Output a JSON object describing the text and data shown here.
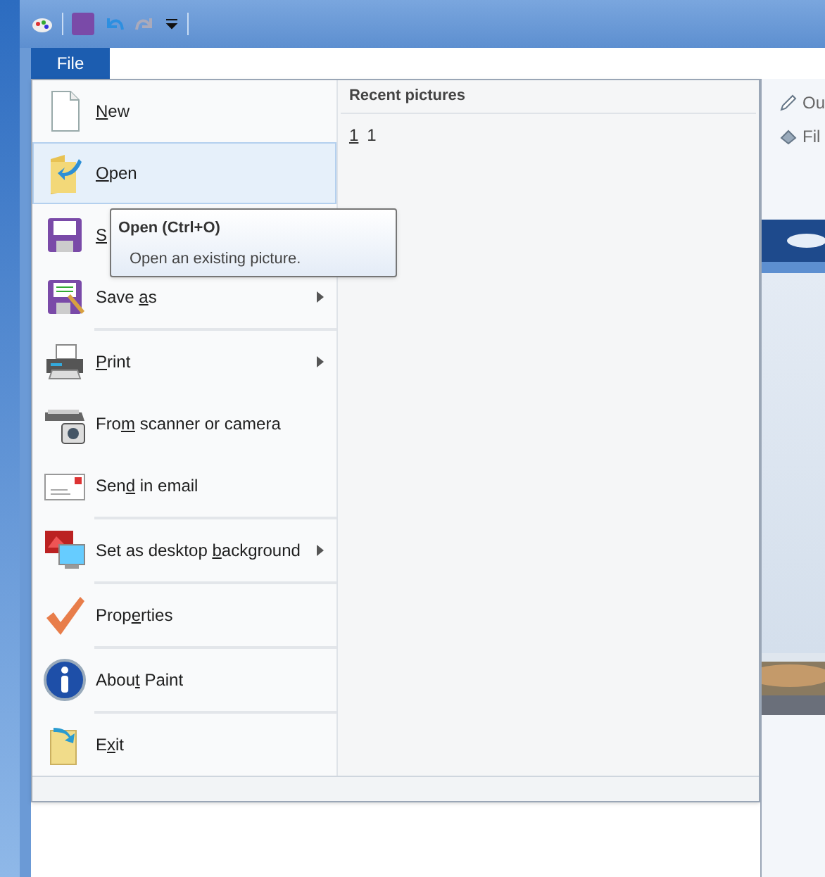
{
  "file_tab": {
    "label": "File",
    "selected": true
  },
  "menu": {
    "sections": [
      [
        {
          "key": "N",
          "post": "ew",
          "selected": false,
          "has_submenu": false
        },
        {
          "key": "O",
          "post": "pen",
          "selected": true,
          "has_submenu": false
        },
        {
          "key": "S",
          "selected": false,
          "has_submenu": false
        },
        {
          "pre": "Save ",
          "key": "a",
          "post": "s",
          "selected": false,
          "has_submenu": true
        }
      ],
      [
        {
          "key": "P",
          "post": "rint",
          "selected": false,
          "has_submenu": true
        },
        {
          "pre": "Fro",
          "key": "m",
          "post": " scanner or camera",
          "selected": false,
          "has_submenu": false
        },
        {
          "pre": "Sen",
          "key": "d",
          "post": " in email",
          "selected": false,
          "has_submenu": false
        }
      ],
      [
        {
          "pre": "Set as desktop ",
          "key": "b",
          "post": "ackground",
          "selected": false,
          "has_submenu": true
        }
      ],
      [
        {
          "pre": "Prop",
          "key": "e",
          "post": "rties",
          "selected": false,
          "has_submenu": false
        }
      ],
      [
        {
          "pre": "Abou",
          "key": "t",
          "post": " Paint",
          "selected": false,
          "has_submenu": false
        }
      ],
      [
        {
          "pre": "E",
          "key": "x",
          "post": "it",
          "selected": false,
          "has_submenu": false
        }
      ]
    ]
  },
  "recent": {
    "title": "Recent pictures",
    "items": [
      {
        "number": "1",
        "name": "1"
      }
    ]
  },
  "tooltip": {
    "title": "Open (Ctrl+O)",
    "text": "Open an existing picture."
  },
  "ribbon_behind": [
    "Ou",
    "Fil"
  ]
}
